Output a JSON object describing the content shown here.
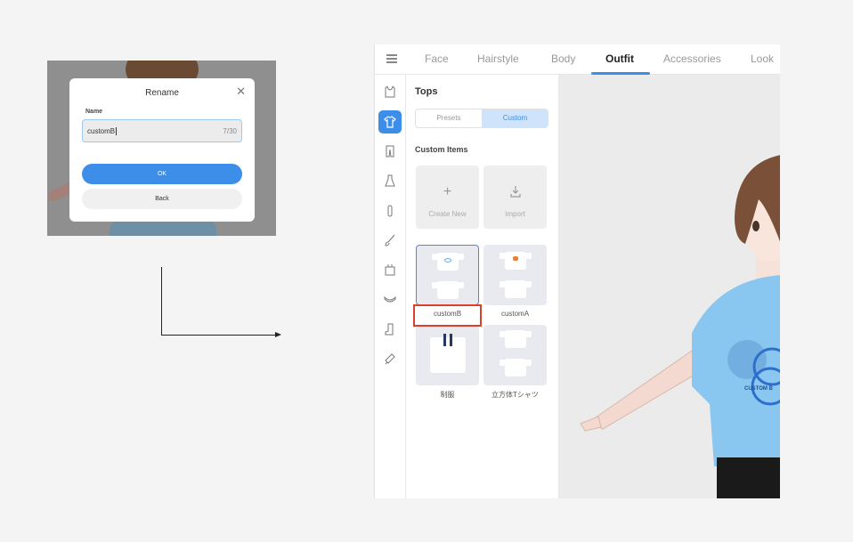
{
  "dialog": {
    "title": "Rename",
    "close_icon": "close-icon",
    "name_label": "Name",
    "name_value": "customB",
    "char_count": "7/30",
    "ok_label": "OK",
    "back_label": "Back"
  },
  "app": {
    "menu_icon": "hamburger-icon",
    "tabs": [
      {
        "label": "Face"
      },
      {
        "label": "Hairstyle"
      },
      {
        "label": "Body"
      },
      {
        "label": "Outfit"
      },
      {
        "label": "Accessories"
      },
      {
        "label": "Look"
      }
    ],
    "active_tab": "Outfit",
    "accent_color": "#3d8ee9",
    "highlight_color": "#d9402e",
    "sidebar_icons": [
      "vest-icon",
      "tshirt-icon",
      "pants-icon",
      "dress-icon",
      "sock-icon",
      "brush-icon",
      "bag-icon",
      "shoe-icon",
      "boot-icon",
      "accessory-icon"
    ],
    "active_sidebar_icon": "tshirt-icon",
    "panel": {
      "title": "Tops",
      "segments": [
        "Presets",
        "Custom"
      ],
      "active_segment": "Custom",
      "section_title": "Custom Items",
      "actions": [
        {
          "label": "Create New",
          "icon": "plus-icon"
        },
        {
          "label": "Import",
          "icon": "import-icon"
        }
      ],
      "items": [
        {
          "label": "customB",
          "selected": true
        },
        {
          "label": "customA",
          "selected": false
        },
        {
          "label": "制服",
          "selected": false
        },
        {
          "label": "立方体Tシャツ",
          "selected": false
        }
      ]
    },
    "model": {
      "shirt_text": "CUSTOM B",
      "shirt_color": "#8ac7f0"
    }
  }
}
